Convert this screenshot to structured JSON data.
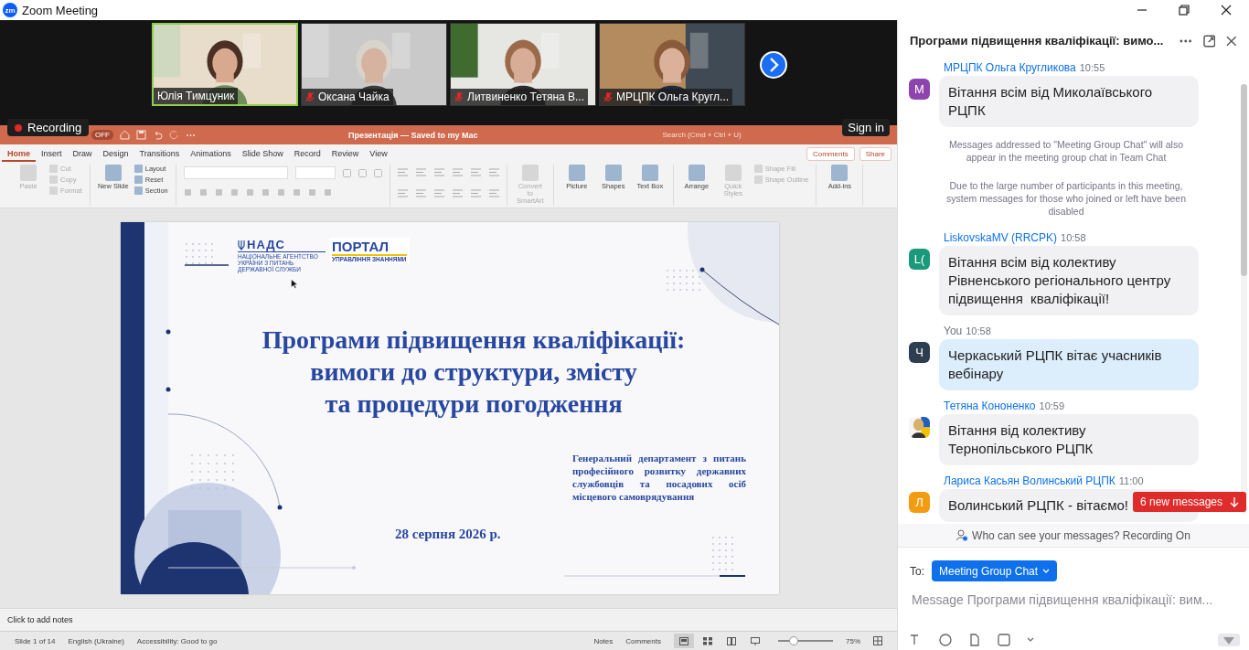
{
  "window": {
    "logo": "zm",
    "title": "Zoom Meeting"
  },
  "videos": [
    {
      "name": "Юлія Тимцуник",
      "muted": false,
      "active": true
    },
    {
      "name": "Оксана Чайка",
      "muted": true,
      "active": false
    },
    {
      "name": "Литвиненко Тетяна В...",
      "muted": true,
      "active": false
    },
    {
      "name": "МРЦПК Ольга Кругл...",
      "muted": true,
      "active": false
    }
  ],
  "recording": "Recording",
  "sign_in": "Sign in",
  "presentation": {
    "autosave": "OFF",
    "title": "Презентація — Saved to my Mac",
    "search_placeholder": "Search (Cmd + Ctrl + U)",
    "tabs": [
      {
        "label": "Home",
        "selected": true
      },
      {
        "label": "Insert",
        "selected": false
      },
      {
        "label": "Draw",
        "selected": false
      },
      {
        "label": "Design",
        "selected": false
      },
      {
        "label": "Transitions",
        "selected": false
      },
      {
        "label": "Animations",
        "selected": false
      },
      {
        "label": "Slide Show",
        "selected": false
      },
      {
        "label": "Record",
        "selected": false
      },
      {
        "label": "Review",
        "selected": false
      },
      {
        "label": "View",
        "selected": false
      }
    ],
    "comments_button": "Comments",
    "share_button": "Share",
    "ribbon": [
      {
        "kind": "items",
        "items": [
          {
            "label": "Paste",
            "kind": "large",
            "disabled": true
          },
          {
            "label": "Cut",
            "kind": "small",
            "disabled": true
          },
          {
            "label": "Copy",
            "kind": "small",
            "disabled": true
          },
          {
            "label": "Format",
            "kind": "small",
            "disabled": true
          }
        ]
      },
      {
        "kind": "items",
        "items": [
          {
            "label": "New Slide",
            "kind": "large",
            "disabled": false
          },
          {
            "label": "Layout",
            "kind": "small",
            "disabled": false
          },
          {
            "label": "Reset",
            "kind": "small",
            "disabled": false
          },
          {
            "label": "Section",
            "kind": "small",
            "disabled": false
          }
        ]
      },
      {
        "kind": "font"
      },
      {
        "kind": "paragraph"
      },
      {
        "kind": "items",
        "items": [
          {
            "label": "Convert to SmartArt",
            "kind": "large",
            "disabled": true
          }
        ]
      },
      {
        "kind": "items",
        "items": [
          {
            "label": "Picture",
            "kind": "large",
            "disabled": false
          },
          {
            "label": "Shapes",
            "kind": "large",
            "disabled": false
          },
          {
            "label": "Text Box",
            "kind": "large",
            "disabled": false
          }
        ]
      },
      {
        "kind": "items",
        "items": [
          {
            "label": "Arrange",
            "kind": "large",
            "disabled": false
          },
          {
            "label": "Quick Styles",
            "kind": "large",
            "disabled": true
          },
          {
            "label": "Shape Fill",
            "kind": "small",
            "disabled": true
          },
          {
            "label": "Shape Outline",
            "kind": "small",
            "disabled": true
          }
        ]
      },
      {
        "kind": "items",
        "items": [
          {
            "label": "Add-ins",
            "kind": "large",
            "disabled": false
          }
        ]
      }
    ],
    "slide": {
      "agency_logo": "НАДС",
      "agency_subtitle": "НАЦІОНАЛЬНЕ АГЕНТСТВО УКРАЇНИ З ПИТАНЬ ДЕРЖАВНОЇ СЛУЖБИ",
      "portal_logo": "ПОРТАЛ",
      "portal_subtitle": "УПРАВЛІННЯ ЗНАННЯМИ",
      "title_lines": [
        "Програми підвищення кваліфікації:",
        "вимоги до структури, змісту",
        "та процедури погодження"
      ],
      "department": "Генеральний департамент з питань професійного розвитку державних службовців та посадових осіб місцевого самоврядування",
      "date": "28 серпня 2026 р."
    },
    "notes_placeholder": "Click to add notes",
    "status": {
      "slide": "Slide 1 of 14",
      "language": "English (Ukraine)",
      "accessibility": "Accessibility: Good to go",
      "notes": "Notes",
      "comments": "Comments",
      "views": [
        {
          "kind": "normal",
          "selected": true
        },
        {
          "kind": "sorter",
          "selected": false
        },
        {
          "kind": "reading",
          "selected": false
        },
        {
          "kind": "slideshow",
          "selected": false
        }
      ],
      "zoom": {
        "level": 0.28
      },
      "zoom_reading": "75%"
    }
  },
  "chat": {
    "title": "Програми підвищення кваліфікації: вимо...",
    "messages": [
      {
        "kind": "message",
        "sender": "МРЦПК Ольга Кругликова",
        "time": "10:55",
        "own": false,
        "avatar": {
          "kind": "letter",
          "letter": "М",
          "color": "#8e44ad"
        },
        "text": "Вітання всім від Миколаївського РЦПК"
      },
      {
        "kind": "system",
        "text": "Messages addressed to \"Meeting Group Chat\" will also appear in the meeting group chat in Team Chat"
      },
      {
        "kind": "system",
        "text": "Due to the large number of participants in this meeting, system messages for those who joined or left have been disabled"
      },
      {
        "kind": "message",
        "sender": "LiskovskaMV (RRCPK)",
        "time": "10:58",
        "own": false,
        "avatar": {
          "kind": "letter",
          "letter": "L(",
          "color": "#1a9a7a"
        },
        "text": "Вітання всім від колективу Рівненського регіонального центру підвищення  кваліфікації!"
      },
      {
        "kind": "message",
        "sender": "You",
        "time": "10:58",
        "own": true,
        "avatar": {
          "kind": "letter",
          "letter": "Ч",
          "color": "#2d3e50"
        },
        "text": "Черкаський РЦПК вітає учасників вебінару"
      },
      {
        "kind": "message",
        "sender": "Тетяна Кононенко",
        "time": "10:59",
        "own": false,
        "text": "Вітання від колективу Тернопільського РЦПК"
      },
      {
        "kind": "message",
        "sender": "Лариса Касьян Волинський РЦПК",
        "time": "11:00",
        "own": false,
        "avatar": {
          "kind": "letter",
          "letter": "Л",
          "color": "#f39c12"
        },
        "text": "Волинський РЦПК - вітаємо!"
      }
    ],
    "new_messages": "6 new messages",
    "privacy_note": "Who can see your messages? Recording On",
    "to_label": "To:",
    "recipient": "Meeting Group Chat",
    "placeholder": "Message Програми підвищення кваліфікації: вим..."
  }
}
